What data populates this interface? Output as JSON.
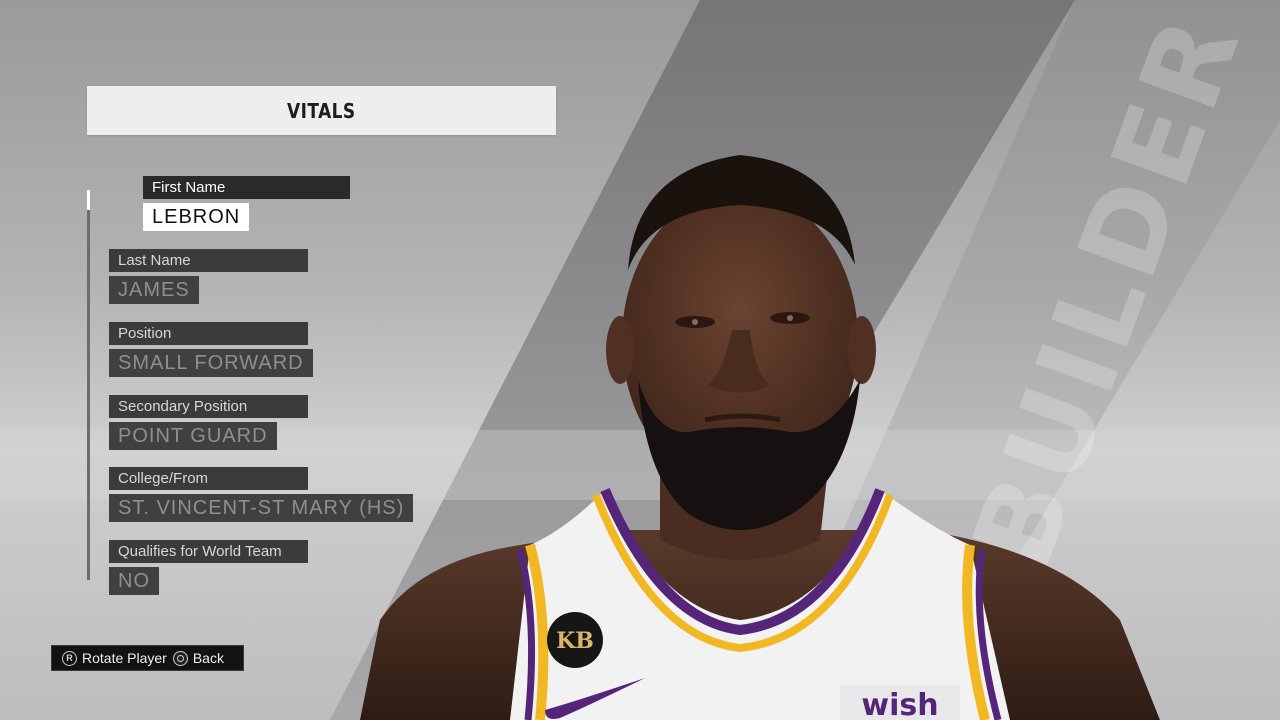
{
  "header": {
    "title": "VITALS"
  },
  "watermark": "BUILDER",
  "fields": [
    {
      "label": "First Name",
      "value": "LEBRON"
    },
    {
      "label": "Last Name",
      "value": "JAMES"
    },
    {
      "label": "Position",
      "value": "SMALL FORWARD"
    },
    {
      "label": "Secondary Position",
      "value": "POINT GUARD"
    },
    {
      "label": "College/From",
      "value": "ST. VINCENT-ST MARY (HS)"
    },
    {
      "label": "Qualifies for World Team",
      "value": "NO"
    }
  ],
  "hints": {
    "rotate_button": "R",
    "rotate_label": "Rotate Player",
    "back_label": "Back"
  },
  "jersey": {
    "sponsor": "wish",
    "patch": "KB"
  },
  "colors": {
    "gold": "#f2b824",
    "purple": "#55257a",
    "panel": "#3b3b3c"
  }
}
